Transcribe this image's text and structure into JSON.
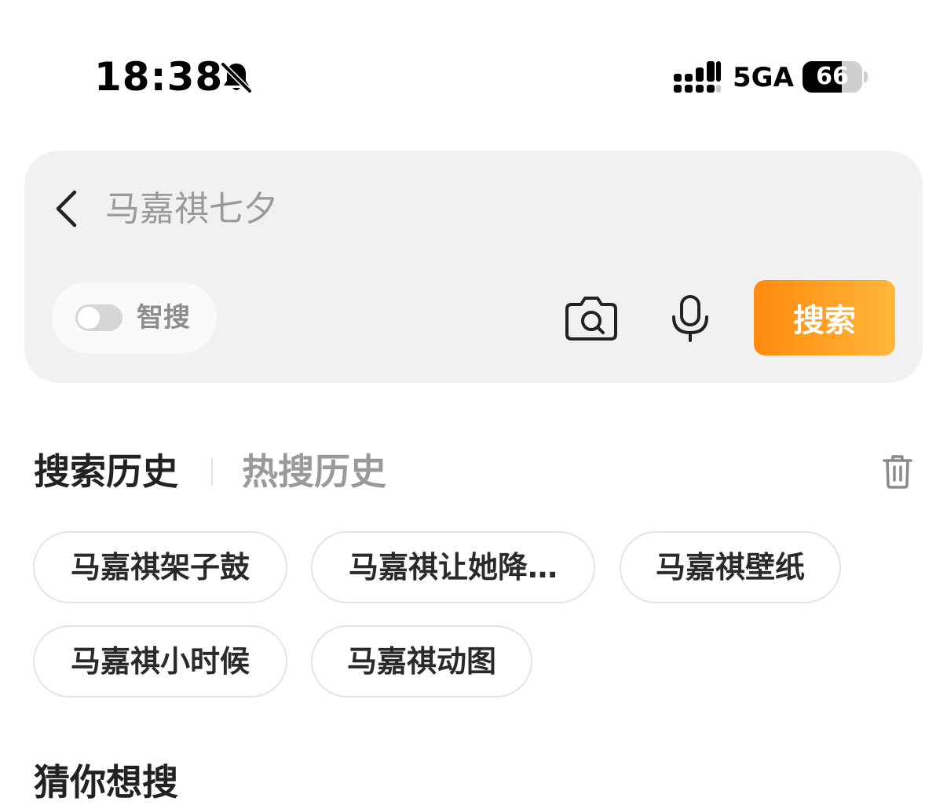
{
  "status_bar": {
    "time": "18:38",
    "network": "5GA",
    "battery": "66",
    "battery_level": 0.66,
    "mute_icon": "bell-slash-icon",
    "signal_icon": "signal-bars-icon"
  },
  "search": {
    "placeholder": "马嘉祺七夕",
    "value": "",
    "smart_toggle_label": "智搜",
    "smart_toggle_on": false,
    "search_button_label": "搜索",
    "back_icon": "chevron-left-icon",
    "camera_icon": "camera-icon",
    "mic_icon": "microphone-icon",
    "accent_color": "#ff8a0f"
  },
  "history": {
    "tabs": [
      {
        "label": "搜索历史",
        "active": true
      },
      {
        "label": "热搜历史",
        "active": false
      }
    ],
    "trash_icon": "trash-icon",
    "items": [
      {
        "label": "马嘉祺架子鼓"
      },
      {
        "label": "马嘉祺让她降…"
      },
      {
        "label": "马嘉祺壁纸"
      },
      {
        "label": "马嘉祺小时候"
      },
      {
        "label": "马嘉祺动图"
      }
    ]
  },
  "next_section": {
    "heading": "猜你想搜"
  }
}
